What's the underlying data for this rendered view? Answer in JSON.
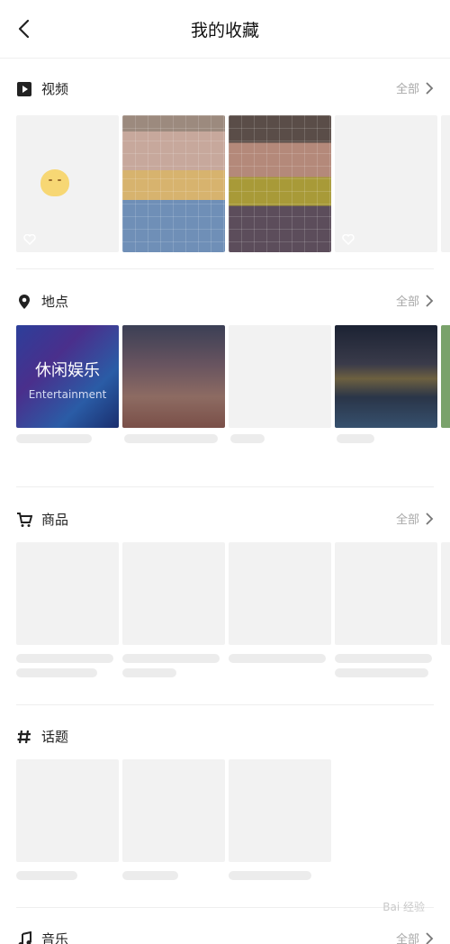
{
  "header": {
    "title": "我的收藏"
  },
  "sections": {
    "video": {
      "title": "视频",
      "more": "全部"
    },
    "place": {
      "title": "地点",
      "more": "全部",
      "tile_cn": "休闲娱乐",
      "tile_en": "Entertainment"
    },
    "goods": {
      "title": "商品",
      "more": "全部"
    },
    "topic": {
      "title": "话题"
    },
    "music": {
      "title": "音乐",
      "more": "全部"
    }
  },
  "watermark": "Bai 经验",
  "colors": {
    "accent_text": "#222222",
    "muted": "#a8a8a8"
  }
}
